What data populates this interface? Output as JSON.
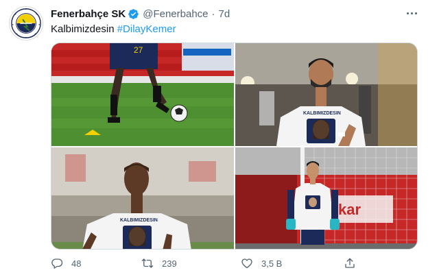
{
  "tweet": {
    "display_name": "Fenerbahçe SK",
    "handle": "@Fenerbahce",
    "separator": "·",
    "time": "7d",
    "text_plain": "Kalbimizdesin",
    "hashtag": "#DilayKemer",
    "avatar_icon": "fenerbahce-crest",
    "verified_icon": "verified-badge-icon",
    "accent_color": "#1d9bf0"
  },
  "media": {
    "photos": [
      {
        "name": "photo-player-feet-ball"
      },
      {
        "name": "photo-player-tshirt-stadium"
      },
      {
        "name": "photo-player-tshirt-field"
      },
      {
        "name": "photo-goalkeeper-tshirt"
      }
    ],
    "shirt_text": "Kalbimizdesin"
  },
  "actions": {
    "reply_count": "48",
    "retweet_count": "239",
    "like_count": "3,5 B",
    "share_label": ""
  },
  "colors": {
    "text_primary": "#0f1419",
    "text_secondary": "#536471",
    "link": "#1d9bf0",
    "border": "#cfd9de"
  }
}
